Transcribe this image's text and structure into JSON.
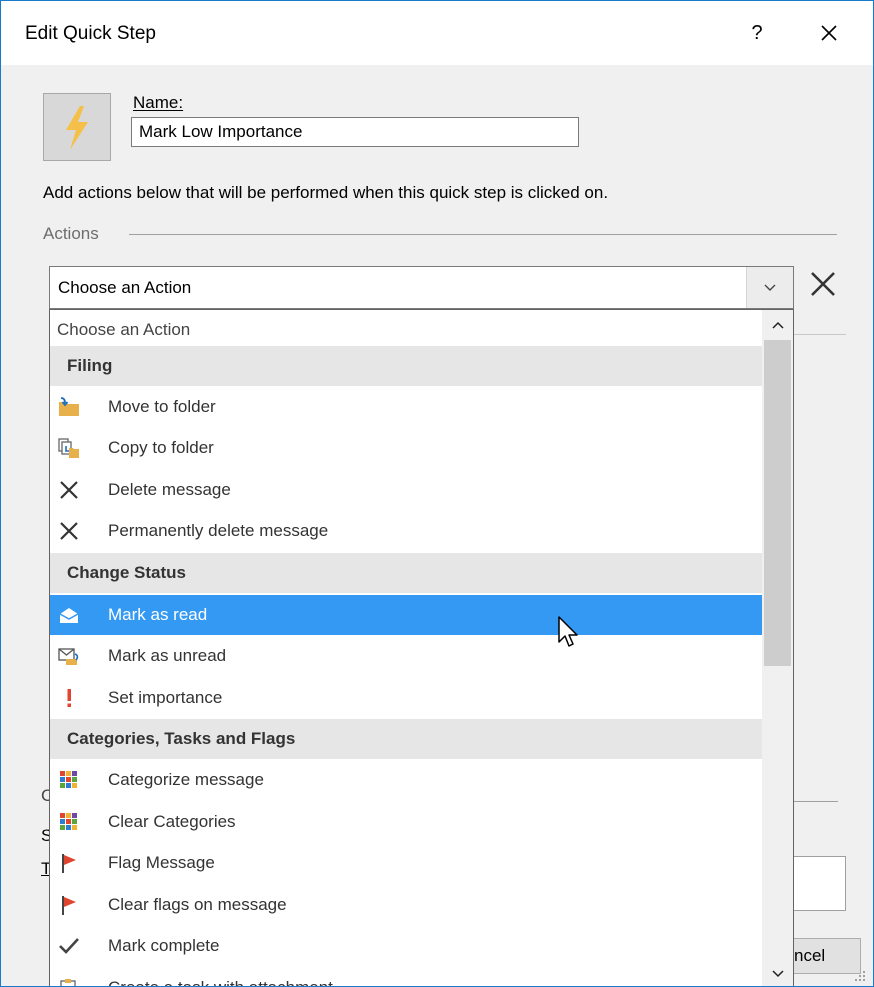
{
  "window": {
    "title": "Edit Quick Step",
    "help_label": "?",
    "close_label": "✕"
  },
  "form": {
    "name_label": "Name:",
    "name_value": "Mark Low Importance",
    "description": "Add actions below that will be performed when this quick step is clicked on.",
    "actions_label": "Actions"
  },
  "action_combo": {
    "value": "Choose an Action",
    "arrow": "⌄"
  },
  "dropdown": {
    "first_item": "Choose an Action",
    "groups": [
      {
        "header": "Filing",
        "items": [
          {
            "label": "Move to folder",
            "icon": "move-to-folder-icon"
          },
          {
            "label": "Copy to folder",
            "icon": "copy-to-folder-icon"
          },
          {
            "label": "Delete message",
            "icon": "delete-icon"
          },
          {
            "label": "Permanently delete message",
            "icon": "permanent-delete-icon"
          }
        ]
      },
      {
        "header": "Change Status",
        "items": [
          {
            "label": "Mark as read",
            "icon": "open-envelope-icon",
            "selected": true
          },
          {
            "label": "Mark as unread",
            "icon": "unread-envelope-icon"
          },
          {
            "label": "Set importance",
            "icon": "importance-icon"
          }
        ]
      },
      {
        "header": "Categories, Tasks and Flags",
        "items": [
          {
            "label": "Categorize message",
            "icon": "categorize-icon"
          },
          {
            "label": "Clear Categories",
            "icon": "clear-categories-icon"
          },
          {
            "label": "Flag Message",
            "icon": "flag-icon"
          },
          {
            "label": "Clear flags on message",
            "icon": "clear-flag-icon"
          },
          {
            "label": "Mark complete",
            "icon": "checkmark-icon"
          },
          {
            "label": "Create a task with attachment",
            "icon": "task-attachment-icon"
          }
        ]
      }
    ]
  },
  "background": {
    "cancel_label": "ncel",
    "frag1": "C",
    "frag2": "S",
    "frag3": "T"
  },
  "colors": {
    "accent_border": "#1979ca",
    "selection": "#3399f3",
    "flag_red": "#e0462f",
    "folder_yellow": "#e8b04a"
  }
}
